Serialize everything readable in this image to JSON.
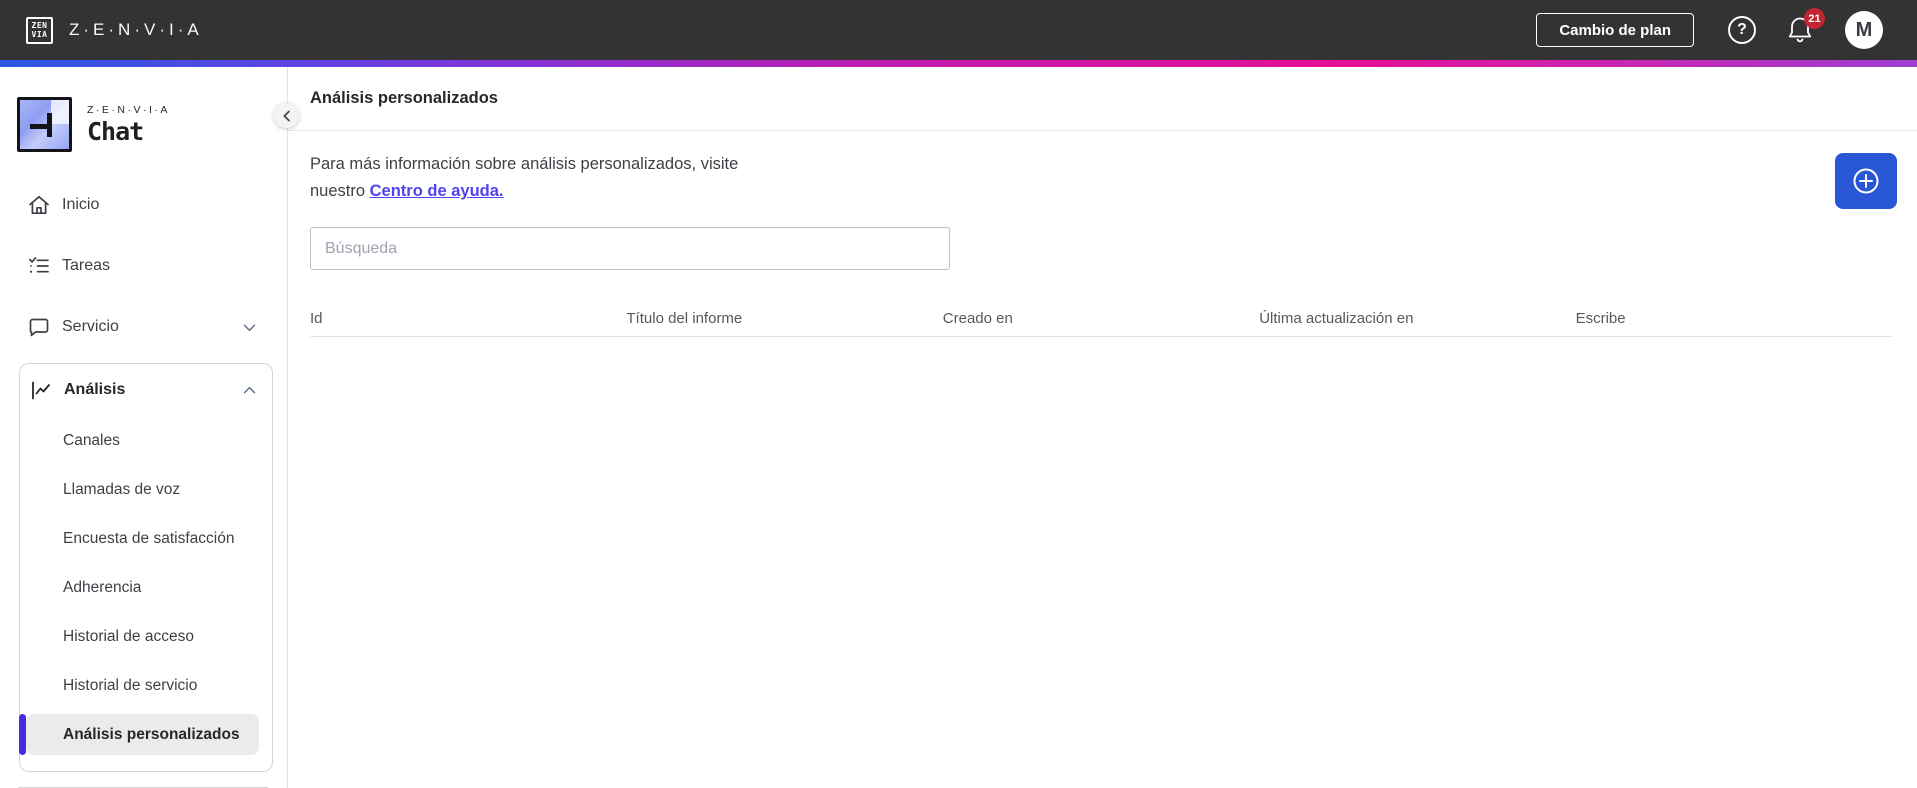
{
  "topbar": {
    "logo_mark_line1": "ZEN",
    "logo_mark_line2": "VIA",
    "brand": "Z·E·N·V·I·A",
    "change_plan_label": "Cambio de plan",
    "help_glyph": "?",
    "notification_count": "21",
    "avatar_initial": "M"
  },
  "sidebar": {
    "logo_brand": "Z·E·N·V·I·A",
    "logo_product": "Chat",
    "items": [
      {
        "label": "Inicio",
        "icon": "home-icon"
      },
      {
        "label": "Tareas",
        "icon": "tasks-icon"
      },
      {
        "label": "Servicio",
        "icon": "chat-bubble-icon"
      }
    ],
    "analysis": {
      "label": "Análisis",
      "icon": "line-chart-icon",
      "expanded": true,
      "subitems": [
        {
          "label": "Canales"
        },
        {
          "label": "Llamadas de voz"
        },
        {
          "label": "Encuesta de satisfacción"
        },
        {
          "label": "Adherencia"
        },
        {
          "label": "Historial de acceso"
        },
        {
          "label": "Historial de servicio"
        },
        {
          "label": "Análisis personalizados"
        }
      ],
      "active_subitem": "Análisis personalizados"
    }
  },
  "main": {
    "title": "Análisis personalizados",
    "intro_text": "Para más información sobre análisis personalizados, visite nuestro ",
    "intro_link": "Centro de ayuda.",
    "search_placeholder": "Búsqueda",
    "table_headers": [
      "Id",
      "Título del informe",
      "Creado en",
      "Última actualización en",
      "Escribe"
    ],
    "table_rows": []
  },
  "colors": {
    "topbar_bg": "#333333",
    "accent_blue": "#2856d4",
    "link_purple": "#5042ef",
    "active_bar_purple": "#4b2be1",
    "badge_red": "#c22534",
    "gradient_stops": [
      "#2b59e6",
      "#7b37dd",
      "#e60f95",
      "#9d3fd4"
    ]
  }
}
